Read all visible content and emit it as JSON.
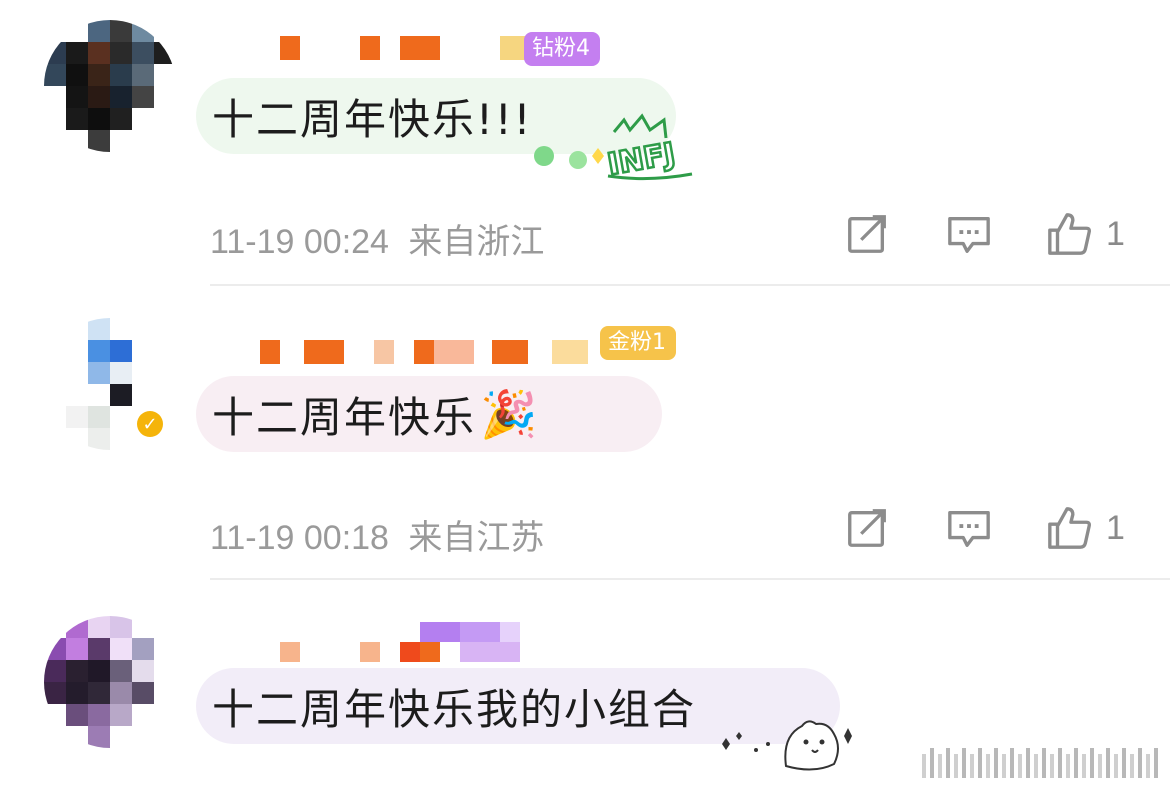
{
  "comments": [
    {
      "fan_badge": "钻粉4",
      "fan_badge_color": "#c47ff0",
      "text": "十二周年快乐!!!",
      "time": "11-19 00:24",
      "location": "来自浙江",
      "likes": "1",
      "sticker": "infj-sticker",
      "bubble_color": "#eef8ee",
      "sticker_text": "INFJ",
      "verified": false
    },
    {
      "fan_badge": "金粉1",
      "fan_badge_color": "#f6c34a",
      "text": "十二周年快乐",
      "text_emoji": "🎉",
      "time": "11-19 00:18",
      "location": "来自江苏",
      "likes": "1",
      "bubble_color": "#f8eef3",
      "verified": true
    },
    {
      "text": "十二周年快乐我的小组合",
      "bubble_color": "#f2edf8",
      "sticker": "bear-sticker"
    }
  ],
  "icons": {
    "repost": "repost-icon",
    "comment": "comment-icon",
    "like": "thumbs-up-icon",
    "verified": "verified-check-icon"
  },
  "colors": {
    "meta_text": "#9a9a9a",
    "divider": "#ececec",
    "icon_stroke": "#8c8c8c"
  }
}
